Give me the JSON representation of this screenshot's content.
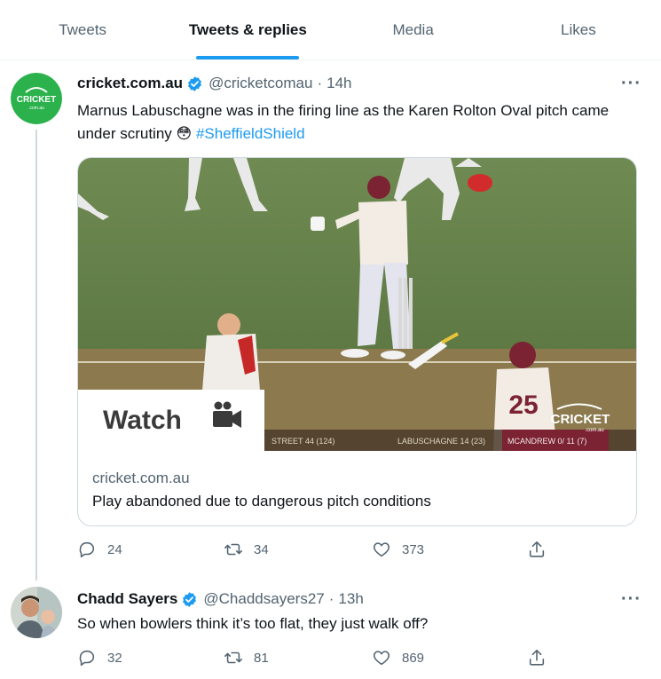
{
  "tabs": [
    {
      "label": "Tweets",
      "active": false
    },
    {
      "label": "Tweets & replies",
      "active": true
    },
    {
      "label": "Media",
      "active": false
    },
    {
      "label": "Likes",
      "active": false
    }
  ],
  "tweet1": {
    "avatar_text": "CRICKET",
    "avatar_subtext": ".com.au",
    "name": "cricket.com.au",
    "handle": "@cricketcomau",
    "separator": "·",
    "time": "14h",
    "more": "···",
    "text": "Marnus Labuschagne was in the firing line as the Karen Rolton Oval pitch came under scrutiny ",
    "emoji": "😳",
    "hashtag": "#SheffieldShield",
    "card": {
      "watch_label": "Watch",
      "logo_text": "CRICKET",
      "logo_subtext": ".com.au",
      "shirt_number": "25",
      "scorebar": [
        "STREET  44 (124)",
        "LABUSCHAGNE  14 (23)",
        "MCANDREW  0/ 11 (7)"
      ],
      "domain": "cricket.com.au",
      "title": "Play abandoned due to dangerous pitch conditions"
    },
    "replies": "24",
    "retweets": "34",
    "likes": "373"
  },
  "tweet2": {
    "name": "Chadd Sayers",
    "handle": "@Chaddsayers27",
    "separator": "·",
    "time": "13h",
    "more": "···",
    "text": "So when bowlers think it’s too flat, they just walk off?",
    "replies": "32",
    "retweets": "81",
    "likes": "869"
  },
  "colors": {
    "accent": "#1d9bf0",
    "brand_green": "#2bb24c",
    "muted": "#536471"
  },
  "icons": [
    "verified-badge-icon",
    "more-icon",
    "reply-icon",
    "retweet-icon",
    "like-icon",
    "share-icon",
    "video-camera-icon"
  ]
}
